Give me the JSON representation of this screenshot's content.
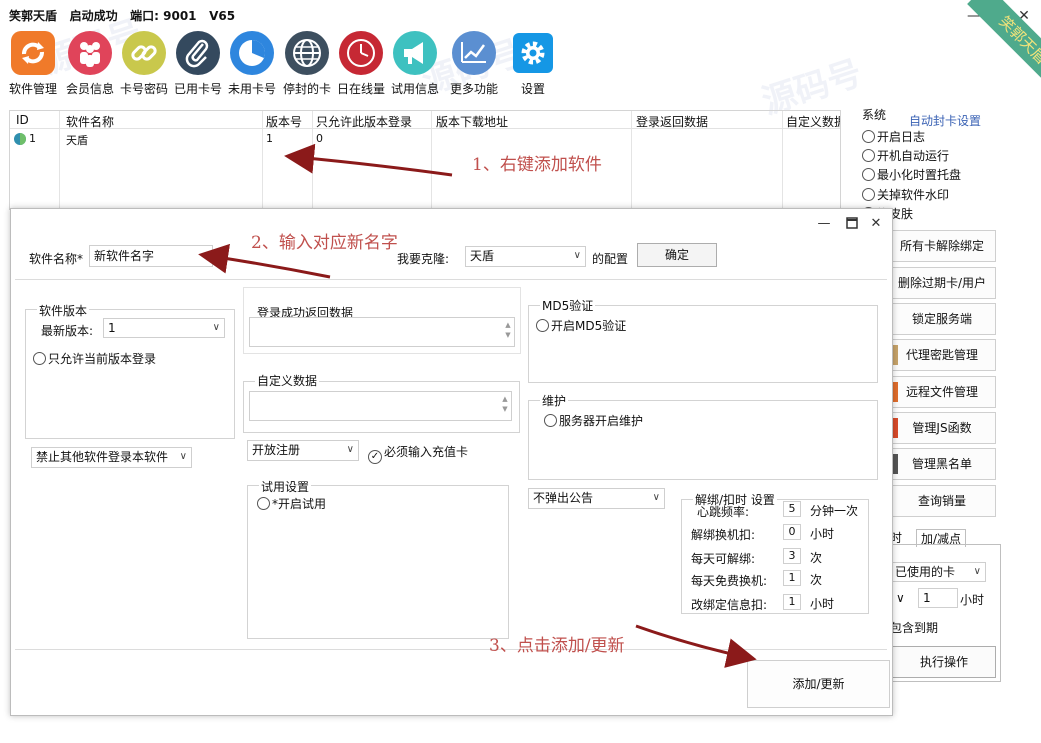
{
  "window": {
    "title": "笑郭天盾",
    "status": "启动成功",
    "port_label": "端口:",
    "port": "9001",
    "version": "V65"
  },
  "toolbar": [
    {
      "label": "软件管理",
      "icon": "software-manage-icon",
      "color": "#f07a2a"
    },
    {
      "label": "会员信息",
      "icon": "members-icon",
      "color": "#e0445a"
    },
    {
      "label": "卡号密码",
      "icon": "card-link-icon",
      "color": "#c9c84c"
    },
    {
      "label": "已用卡号",
      "icon": "paperclip-icon",
      "color": "#34495e"
    },
    {
      "label": "未用卡号",
      "icon": "pie-icon",
      "color": "#2e86de"
    },
    {
      "label": "停封的卡",
      "icon": "globe-icon",
      "color": "#3d4f5f"
    },
    {
      "label": "日在线量",
      "icon": "clock-icon",
      "color": "#c62834"
    },
    {
      "label": "试用信息",
      "icon": "megaphone-icon",
      "color": "#3ec1c0"
    },
    {
      "label": "更多功能",
      "icon": "chart-icon",
      "color": "#5b8fd1"
    },
    {
      "label": "设置",
      "icon": "gear-icon",
      "color": "#1597e5"
    }
  ],
  "software_table": {
    "columns": [
      "ID",
      "软件名称",
      "版本号",
      "只允许此版本登录",
      "版本下载地址",
      "登录返回数据",
      "自定义数据"
    ],
    "rows": [
      {
        "id": "1",
        "name": "天盾",
        "version": "1",
        "only_version": "0"
      }
    ]
  },
  "right_panel": {
    "system_label": "系统",
    "auto_ban_label": "自动封卡设置",
    "options": [
      "开启日志",
      "开机自动运行",
      "最小化时置托盘",
      "关掉软件水印",
      "换皮肤"
    ],
    "buttons": [
      "所有卡解除绑定",
      "删除过期卡/用户",
      "锁定服务端",
      "代理密匙管理",
      "远程文件管理",
      "管理JS函数",
      "管理黑名单",
      "查询销量"
    ],
    "tabs": [
      "时",
      "加/减点"
    ],
    "used_card_select": "已使用的卡",
    "amount_value": "1",
    "amount_unit": "小时",
    "include_expired": "包含到期",
    "execute_button": "执行操作"
  },
  "dialog": {
    "software_name_label": "软件名称*",
    "software_name_value": "新软件名字",
    "clone_label": "我要克隆:",
    "clone_value": "天盾",
    "config_label": "的配置",
    "confirm_button": "确定",
    "version_group": {
      "title": "软件版本",
      "latest_label": "最新版本:",
      "latest_value": "1",
      "only_current": "只允许当前版本登录"
    },
    "forbid_select": "禁止其他软件登录本软件",
    "login_return_title": "登录成功返回数据",
    "custom_data_title": "自定义数据",
    "register_select": "开放注册",
    "must_recharge": "必须输入充值卡",
    "trial_group": {
      "title": "试用设置",
      "enable_trial": "*开启试用"
    },
    "md5_group": {
      "title": "MD5验证",
      "enable_md5": "开启MD5验证"
    },
    "maintain_group": {
      "title": "维护",
      "server_maintain": "服务器开启维护"
    },
    "notice_select": "不弹出公告",
    "bind_group": {
      "title": "解绑/扣时 设置",
      "rows": [
        {
          "label": "心跳频率:",
          "value": "5",
          "unit": "分钟一次"
        },
        {
          "label": "解绑换机扣:",
          "value": "0",
          "unit": "小时"
        },
        {
          "label": "每天可解绑:",
          "value": "3",
          "unit": "次"
        },
        {
          "label": "每天免费换机:",
          "value": "1",
          "unit": "次"
        },
        {
          "label": "改绑定信息扣:",
          "value": "1",
          "unit": "小时"
        }
      ]
    },
    "add_update_button": "添加/更新"
  },
  "annotations": {
    "step1": "1、右键添加软件",
    "step2": "2、输入对应新名字",
    "step3": "3、点击添加/更新",
    "color": "#c0504d"
  },
  "watermark": {
    "text": "源码号",
    "ribbon": "笑郭天盾"
  }
}
